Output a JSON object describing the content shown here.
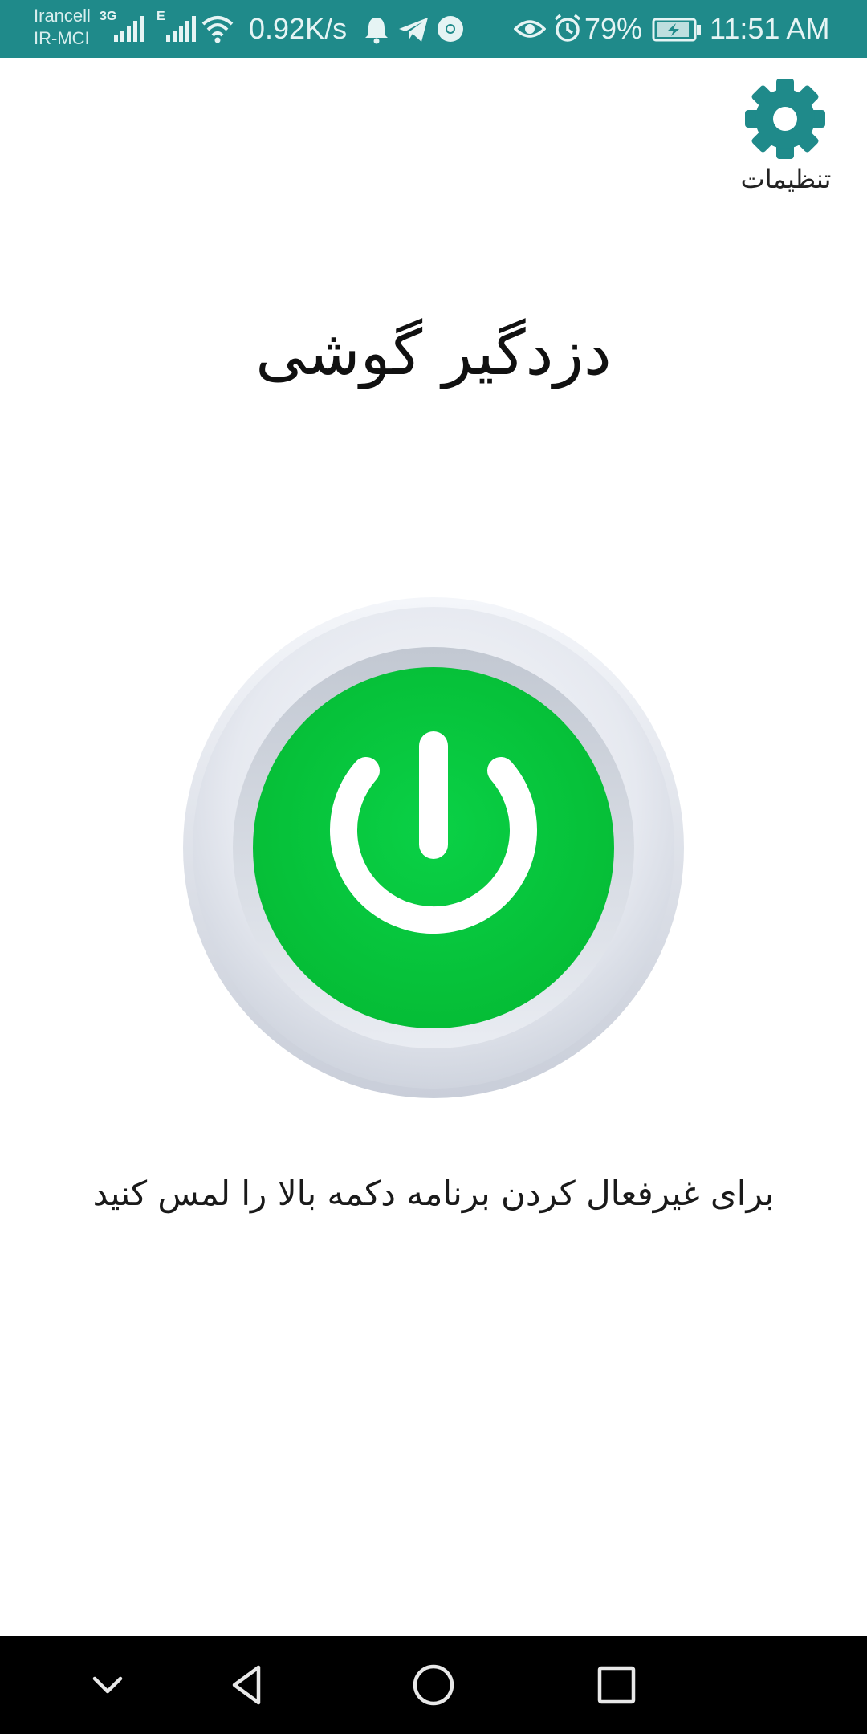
{
  "status_bar": {
    "carrier_1": "Irancell",
    "carrier_2": "IR-MCI",
    "network_1": "3G",
    "network_2": "E",
    "speed": "0.92K/s",
    "battery": "79%",
    "time": "11:51 AM"
  },
  "settings": {
    "label": "تنظیمات"
  },
  "app": {
    "title": "دزدگیر گوشی",
    "hint": "برای غیرفعال کردن برنامه دکمه بالا را لمس کنید"
  },
  "colors": {
    "status_bar": "#1f8a8a",
    "accent": "#1f8a8a",
    "power_green": "#06c83c",
    "nav_bar": "#000000"
  },
  "icons": {
    "settings": "gear-icon",
    "power": "power-icon",
    "nav_collapse": "chevron-down-icon",
    "nav_back": "back-triangle-icon",
    "nav_home": "home-circle-icon",
    "nav_recents": "recents-square-icon"
  }
}
